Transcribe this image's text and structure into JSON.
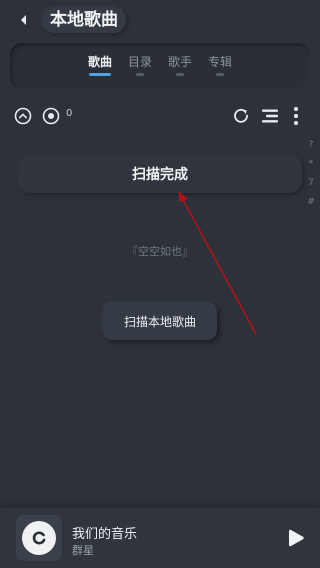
{
  "header": {
    "title": "本地歌曲"
  },
  "tabs": [
    {
      "label": "歌曲",
      "active": true
    },
    {
      "label": "目录",
      "active": false
    },
    {
      "label": "歌手",
      "active": false
    },
    {
      "label": "专辑",
      "active": false
    }
  ],
  "toolbar": {
    "count": "0",
    "icons": [
      "collapse-up-icon",
      "record-icon",
      "refresh-icon",
      "sort-list-icon",
      "more-vertical-icon"
    ]
  },
  "scan_status": {
    "text": "扫描完成"
  },
  "empty_state": {
    "text": "『空空如也』"
  },
  "scan_button": {
    "label": "扫描本地歌曲"
  },
  "alpha_index": [
    "?",
    "*",
    "7",
    "#"
  ],
  "player": {
    "song_title": "我们的音乐",
    "artist": "群星"
  },
  "colors": {
    "background": "#2d323a",
    "accent": "#4da3e6",
    "annotation_arrow": "#b3101a"
  }
}
